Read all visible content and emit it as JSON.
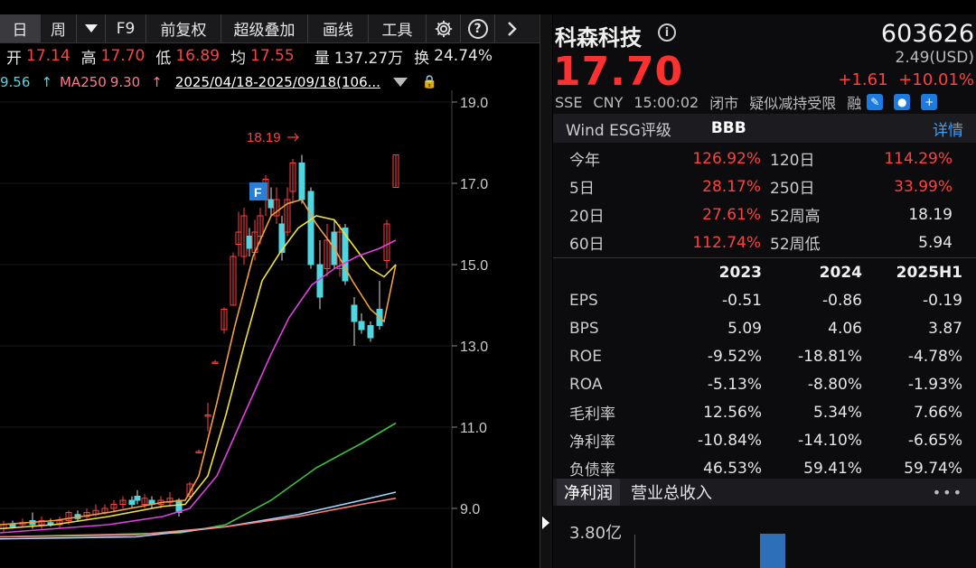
{
  "toolbar": {
    "items": [
      "日",
      "周",
      "F9",
      "前复权",
      "超级叠加",
      "画线",
      "工具"
    ],
    "dropdown_icon": "caret-down-icon",
    "settings_icon": "gear-icon",
    "help_label": "?",
    "next_icon": "chevron-right-icon"
  },
  "quote": {
    "open_label": "开",
    "open": "17.14",
    "high_label": "高",
    "high": "17.70",
    "low_label": "低",
    "low": "16.89",
    "avg_label": "均",
    "avg": "17.55",
    "vol_label": "量",
    "vol": "137.27万",
    "turn_label": "换",
    "turn": "24.74%"
  },
  "ma_row": {
    "ma_prev_value": "9.56",
    "ma_prev_arrow": "↑",
    "ma250_label": "MA250",
    "ma250_value": "9.30",
    "ma250_arrow": "↑",
    "range": "2025/04/18-2025/09/18(106..."
  },
  "chart": {
    "y_labels": [
      "19.0",
      "17.0",
      "15.0",
      "13.0",
      "11.0",
      "9.0"
    ],
    "peak_label": "18.19",
    "f_marker": "F"
  },
  "panel": {
    "name": "科森科技",
    "info_icon": "i",
    "code": "603626",
    "price": "17.70",
    "usd": "2.49(USD)",
    "change": "+1.61",
    "change_pct": "+10.01%",
    "exchange": "SSE",
    "currency": "CNY",
    "time": "15:00:02",
    "status": "闭市",
    "notice": "疑似减持受限",
    "margin_label": "融",
    "esg_label": "Wind ESG评级",
    "esg_value": "BBB",
    "esg_detail": "详情"
  },
  "performance": [
    {
      "l1": "今年",
      "v1": "126.92%",
      "l2": "120日",
      "v2": "114.29%",
      "v2_color": "red"
    },
    {
      "l1": "5日",
      "v1": "28.17%",
      "l2": "250日",
      "v2": "33.99%",
      "v2_color": "red"
    },
    {
      "l1": "20日",
      "v1": "27.61%",
      "l2": "52周高",
      "v2": "18.19",
      "v2_color": "white"
    },
    {
      "l1": "60日",
      "v1": "112.74%",
      "l2": "52周低",
      "v2": "5.94",
      "v2_color": "white"
    }
  ],
  "financials": {
    "headers": [
      "",
      "2023",
      "2024",
      "2025H1"
    ],
    "rows": [
      [
        "EPS",
        "-0.51",
        "-0.86",
        "-0.19"
      ],
      [
        "BPS",
        "5.09",
        "4.06",
        "3.87"
      ],
      [
        "ROE",
        "-9.52%",
        "-18.81%",
        "-4.78%"
      ],
      [
        "ROA",
        "-5.13%",
        "-8.80%",
        "-1.93%"
      ],
      [
        "毛利率",
        "12.56%",
        "5.34%",
        "7.66%"
      ],
      [
        "净利率",
        "-10.84%",
        "-14.10%",
        "-6.65%"
      ],
      [
        "负债率",
        "46.53%",
        "59.41%",
        "59.74%"
      ]
    ]
  },
  "bottom": {
    "tabs": [
      "净利润",
      "营业总收入"
    ],
    "more": "•••",
    "axis_label": "3.80亿"
  },
  "colors": {
    "up": "#ff4040",
    "down": "#4fd6e0",
    "ma5": "#f0a040",
    "ma10": "#f0e040",
    "ma20": "#e040e0",
    "ma60": "#40c040",
    "ma120": "#a0d8ff",
    "ma250": "#ff8080"
  }
}
